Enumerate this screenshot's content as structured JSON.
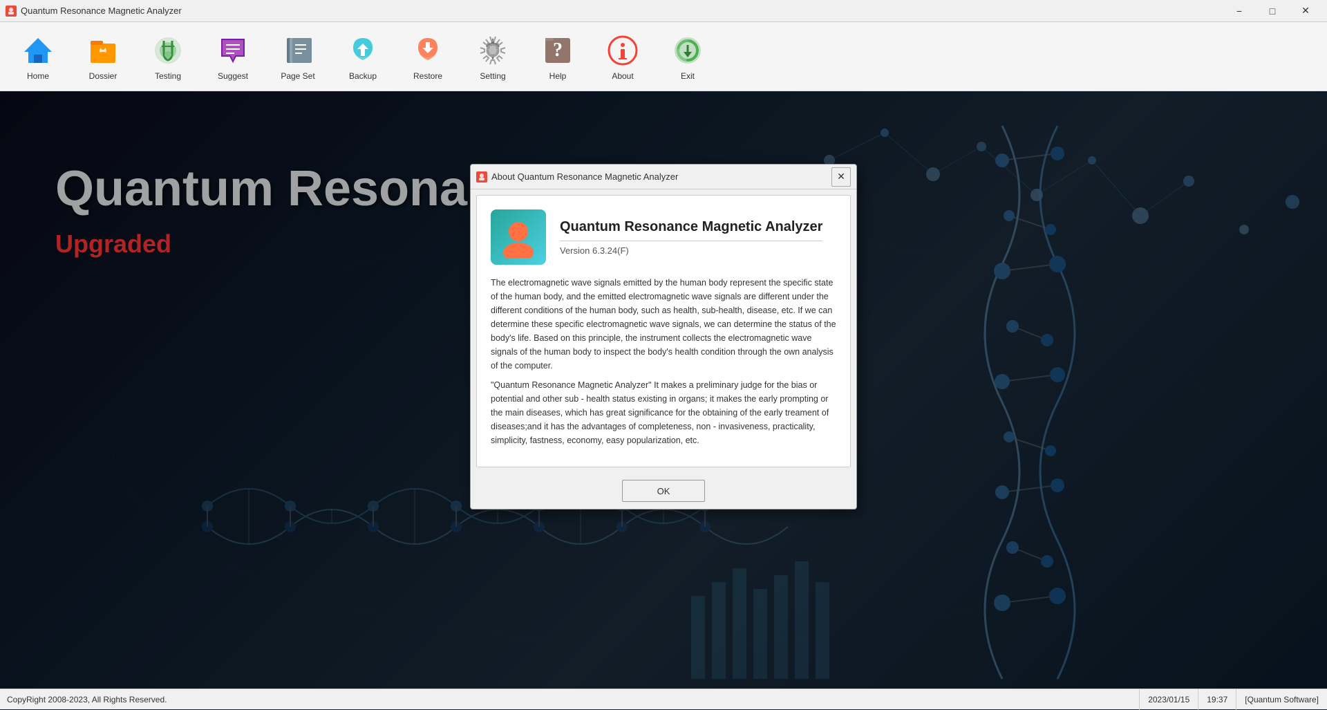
{
  "app": {
    "title": "Quantum Resonance Magnetic Analyzer",
    "version": "Version 6.3.24(F)"
  },
  "titlebar": {
    "title": "Quantum Resonance Magnetic Analyzer",
    "minimize_label": "−",
    "maximize_label": "□",
    "close_label": "✕"
  },
  "toolbar": {
    "items": [
      {
        "id": "home",
        "label": "Home",
        "icon": "home"
      },
      {
        "id": "dossier",
        "label": "Dossier",
        "icon": "dossier"
      },
      {
        "id": "testing",
        "label": "Testing",
        "icon": "testing"
      },
      {
        "id": "suggest",
        "label": "Suggest",
        "icon": "suggest"
      },
      {
        "id": "pageset",
        "label": "Page Set",
        "icon": "pageset"
      },
      {
        "id": "backup",
        "label": "Backup",
        "icon": "backup"
      },
      {
        "id": "restore",
        "label": "Restore",
        "icon": "restore"
      },
      {
        "id": "setting",
        "label": "Setting",
        "icon": "setting"
      },
      {
        "id": "help",
        "label": "Help",
        "icon": "help"
      },
      {
        "id": "about",
        "label": "About",
        "icon": "about"
      },
      {
        "id": "exit",
        "label": "Exit",
        "icon": "exit"
      }
    ]
  },
  "background": {
    "title": "Quantum Resona",
    "subtitle": "Upgraded"
  },
  "dialog": {
    "title": "About Quantum Resonance Magnetic Analyzer",
    "app_name": "Quantum Resonance Magnetic Analyzer",
    "version": "Version 6.3.24(F)",
    "description_1": "The electromagnetic wave signals emitted by the human body represent the specific state of the human body, and the emitted electromagnetic wave signals are different under the different conditions of the human body, such as health, sub-health, disease, etc. If we can determine these specific electromagnetic wave signals, we can determine the status of the body's life. Based on this principle, the instrument collects the electromagnetic wave signals of the human body to inspect the body's health condition through the own analysis of the computer.",
    "description_2": "\"Quantum Resonance Magnetic Analyzer\" It makes a preliminary judge for the bias or potential and other sub - health status existing in organs; it makes the early prompting or the main diseases, which has great significance for the obtaining of the early treament of diseases;and it has the advantages of completeness, non - invasiveness, practicality, simplicity, fastness, economy, easy popularization, etc.",
    "ok_button": "OK",
    "close_icon": "✕"
  },
  "statusbar": {
    "copyright": "CopyRight 2008-2023, All Rights Reserved.",
    "date": "2023/01/15",
    "time": "19:37",
    "software": "[Quantum Software]"
  }
}
